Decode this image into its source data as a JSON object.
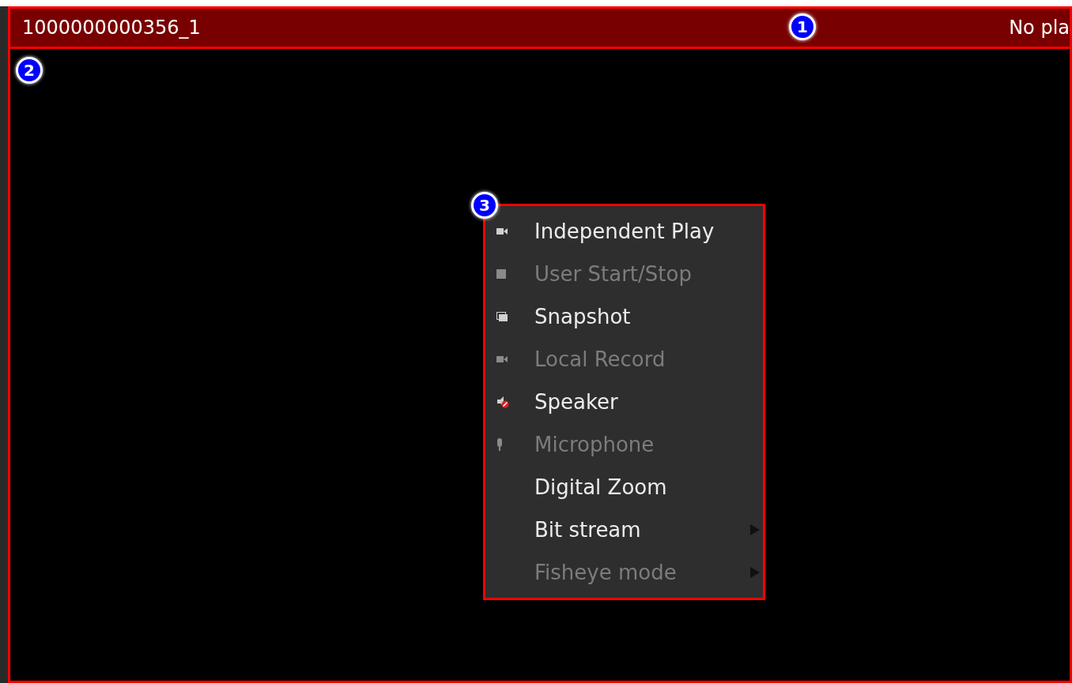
{
  "header": {
    "title": "1000000000356_1",
    "status": "No pla"
  },
  "callouts": [
    {
      "label": "1"
    },
    {
      "label": "2"
    },
    {
      "label": "3"
    }
  ],
  "menu": {
    "items": [
      {
        "label": "Independent Play",
        "kind": "camera",
        "disabled": false,
        "submenu": false
      },
      {
        "label": "User Start/Stop",
        "kind": "stop",
        "disabled": true,
        "submenu": false
      },
      {
        "label": "Snapshot",
        "kind": "picture",
        "disabled": false,
        "submenu": false
      },
      {
        "label": "Local Record",
        "kind": "camera",
        "disabled": true,
        "submenu": false
      },
      {
        "label": "Speaker",
        "kind": "speaker",
        "disabled": false,
        "submenu": false
      },
      {
        "label": "Microphone",
        "kind": "mic",
        "disabled": true,
        "submenu": false
      },
      {
        "label": "Digital Zoom",
        "kind": "plain",
        "disabled": false,
        "submenu": false
      },
      {
        "label": "Bit stream",
        "kind": "plain",
        "disabled": false,
        "submenu": true
      },
      {
        "label": "Fisheye mode",
        "kind": "plain",
        "disabled": true,
        "submenu": true
      }
    ]
  }
}
